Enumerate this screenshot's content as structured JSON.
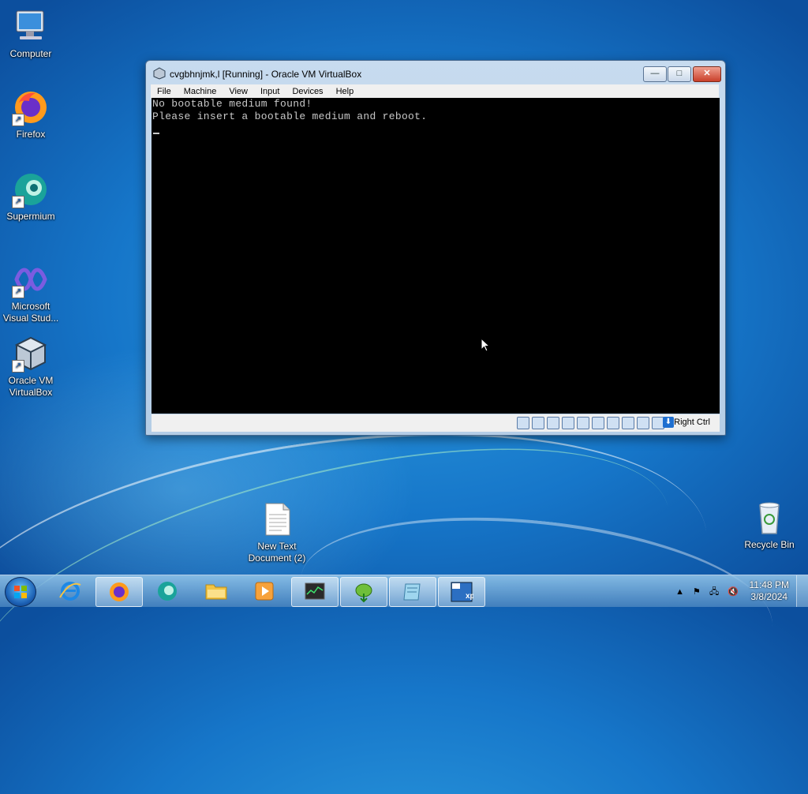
{
  "desktop": {
    "icons": [
      {
        "label": "Computer"
      },
      {
        "label": "Firefox"
      },
      {
        "label": "Supermium"
      },
      {
        "label": "Microsoft Visual Stud..."
      },
      {
        "label": "Oracle VM VirtualBox"
      },
      {
        "label": "New Text Document (2)"
      },
      {
        "label": "Recycle Bin"
      }
    ]
  },
  "vbox": {
    "title": "cvgbhnjmk,l [Running] - Oracle VM VirtualBox",
    "buttons": {
      "minimize": "—",
      "maximize": "□",
      "close": "✕"
    },
    "menu": [
      "File",
      "Machine",
      "View",
      "Input",
      "Devices",
      "Help"
    ],
    "screen_lines": [
      "No bootable medium found!",
      "Please insert a bootable medium and reboot."
    ],
    "host_key": "Right Ctrl"
  },
  "taskbar": {
    "items": [
      {
        "icon": "internet-explorer-icon"
      },
      {
        "icon": "firefox-icon"
      },
      {
        "icon": "supermium-icon"
      },
      {
        "icon": "file-explorer-icon"
      },
      {
        "icon": "media-player-icon"
      },
      {
        "icon": "task-manager-icon"
      },
      {
        "icon": "gecko-download-icon"
      },
      {
        "icon": "notepad-icon"
      },
      {
        "icon": "virtualbox-xp-icon"
      }
    ],
    "tray": {
      "arrow": "▲",
      "flag": "⚑",
      "network": "🖧",
      "volume": "🔇"
    },
    "clock": {
      "time": "11:48 PM",
      "date": "3/8/2024"
    }
  }
}
